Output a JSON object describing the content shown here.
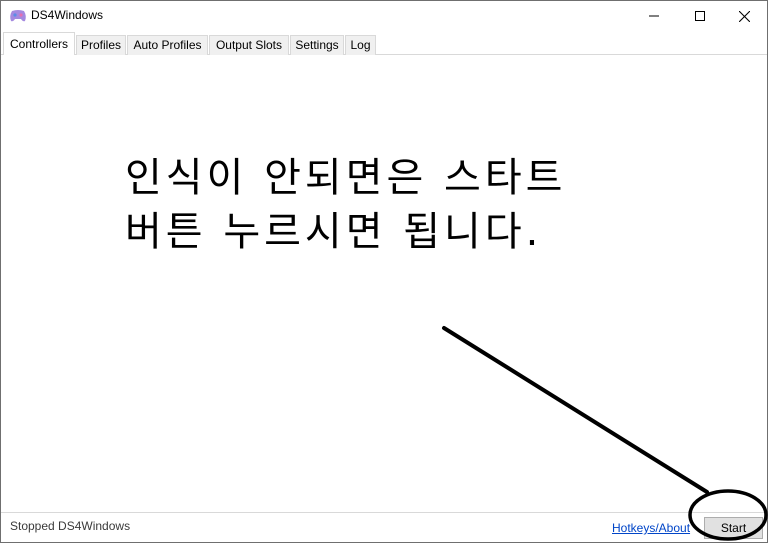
{
  "window": {
    "title": "DS4Windows",
    "icon": "gamepad-icon"
  },
  "window_controls": {
    "minimize_icon": "minimize-icon",
    "maximize_icon": "maximize-icon",
    "close_icon": "close-icon"
  },
  "tabs": [
    {
      "label": "Controllers",
      "active": true
    },
    {
      "label": "Profiles",
      "active": false
    },
    {
      "label": "Auto Profiles",
      "active": false
    },
    {
      "label": "Output Slots",
      "active": false
    },
    {
      "label": "Settings",
      "active": false
    },
    {
      "label": "Log",
      "active": false
    }
  ],
  "annotation": {
    "line1": "인식이 안되면은 스타트",
    "line2": "버튼 누르시면 됩니다.",
    "color": "#000000"
  },
  "status": {
    "text": "Stopped DS4Windows",
    "hotkeys_link": "Hotkeys/About",
    "start_label": "Start"
  }
}
